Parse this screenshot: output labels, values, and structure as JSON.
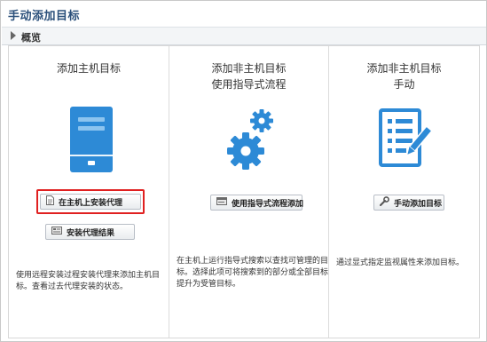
{
  "page": {
    "title": "手动添加目标"
  },
  "overview": {
    "label": "概览"
  },
  "columns": [
    {
      "title": "添加主机目标",
      "icon": "server-icon",
      "buttons": [
        {
          "label": "在主机上安装代理",
          "icon": "document-icon",
          "highlighted": true
        },
        {
          "label": "安装代理结果",
          "icon": "results-icon",
          "highlighted": false
        }
      ],
      "description": [
        "使用远程安装过程安装代理来添加主机目",
        "标。查看过去代理安装的状态。"
      ]
    },
    {
      "title_lines": [
        "添加非主机目标",
        "使用指导式流程"
      ],
      "icon": "gears-icon",
      "buttons": [
        {
          "label": "使用指导式流程添加",
          "icon": "wizard-icon"
        }
      ],
      "description": [
        "在主机上运行指导式搜索以查找可管理的目",
        "标。选择此项可将搜索到的部分或全部目标",
        "提升为受管目标。"
      ]
    },
    {
      "title_lines": [
        "添加非主机目标",
        "手动"
      ],
      "icon": "list-edit-icon",
      "buttons": [
        {
          "label": "手动添加目标",
          "icon": "wrench-icon"
        }
      ],
      "description": [
        "通过显式指定监视属性来添加目标。"
      ]
    }
  ],
  "colors": {
    "accent_blue": "#2d8ad6",
    "highlight_red": "#e02020",
    "title_text": "#2a4f7a"
  }
}
